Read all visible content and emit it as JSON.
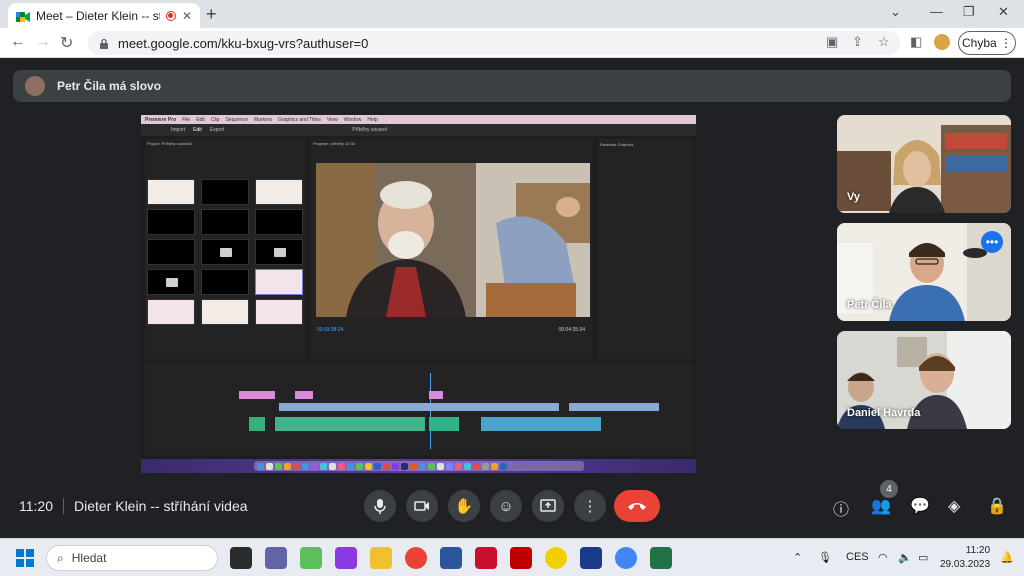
{
  "browser": {
    "tab_title": "Meet – Dieter Klein -- stříhání",
    "url": "meet.google.com/kku-bxug-vrs?authuser=0",
    "profile_label": "Chyba"
  },
  "meet": {
    "speaker_banner": "Petr Čila má slovo",
    "time": "11:20",
    "meeting_title": "Dieter Klein -- stříhání videa",
    "participants_count": "4",
    "tiles": [
      {
        "name": "Vy"
      },
      {
        "name": "Petr Čila"
      },
      {
        "name": "Daniel Havrda"
      }
    ]
  },
  "shared_screen": {
    "app_menu": [
      "Premiere Pro",
      "File",
      "Edit",
      "Clip",
      "Sequence",
      "Markers",
      "Graphics and Titles",
      "View",
      "Window",
      "Help"
    ],
    "header_tabs": [
      "Import",
      "Edit",
      "Export"
    ],
    "project_name": "Příběhy soused",
    "project_panel_label": "Project: Příběhy sousedů",
    "program_label": "Program: příběhy 10:30",
    "timecode": "00:03:38:24",
    "duration": "00:04:35:34",
    "graphics_label": "Essential Graphics"
  },
  "taskbar": {
    "search_placeholder": "Hledat",
    "language": "CES",
    "clock_time": "11:20",
    "clock_date": "29.03.2023"
  }
}
